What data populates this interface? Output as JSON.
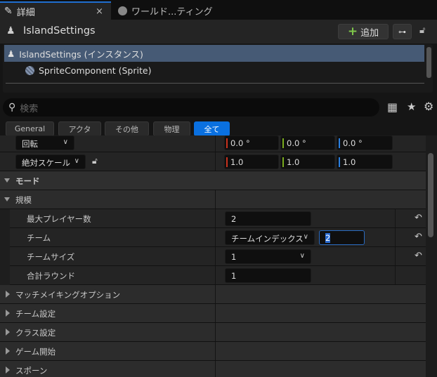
{
  "tabs": [
    {
      "label": "詳細",
      "icon": "pencil-icon",
      "close": "×"
    },
    {
      "label": "ワールド...ティング",
      "icon": "globe-icon"
    }
  ],
  "header": {
    "title": "IslandSettings",
    "add_label": "追加",
    "add_icon": "+"
  },
  "tree": {
    "items": [
      {
        "label": "IslandSettings (インスタンス)",
        "selected": true
      },
      {
        "label": "SpriteComponent (Sprite)"
      }
    ]
  },
  "search": {
    "placeholder": "検索"
  },
  "filters": [
    {
      "label": "General"
    },
    {
      "label": "アクタ"
    },
    {
      "label": "その他"
    },
    {
      "label": "物理"
    },
    {
      "label": "全て",
      "active": true
    }
  ],
  "transform": {
    "rotation_label": "回転",
    "rotation": [
      "0.0 °",
      "0.0 °",
      "0.0 °"
    ],
    "scale_label": "絶対スケール",
    "scale": [
      "1.0",
      "1.0",
      "1.0"
    ],
    "axis_colors": [
      "#c8321e",
      "#7aab1e",
      "#2a7fe0"
    ]
  },
  "sections": {
    "mode": "モード",
    "scale_group": "規模"
  },
  "props": {
    "max_players": {
      "label": "最大プレイヤー数",
      "value": "2"
    },
    "team": {
      "label": "チーム",
      "mode": "チームインデックス",
      "value": "2"
    },
    "team_size": {
      "label": "チームサイズ",
      "value": "1"
    },
    "total_rounds": {
      "label": "合計ラウンド",
      "value": "1"
    }
  },
  "categories": [
    "マッチメイキングオプション",
    "チーム設定",
    "クラス設定",
    "ゲーム開始",
    "スポーン"
  ],
  "reset_icon": "↶"
}
